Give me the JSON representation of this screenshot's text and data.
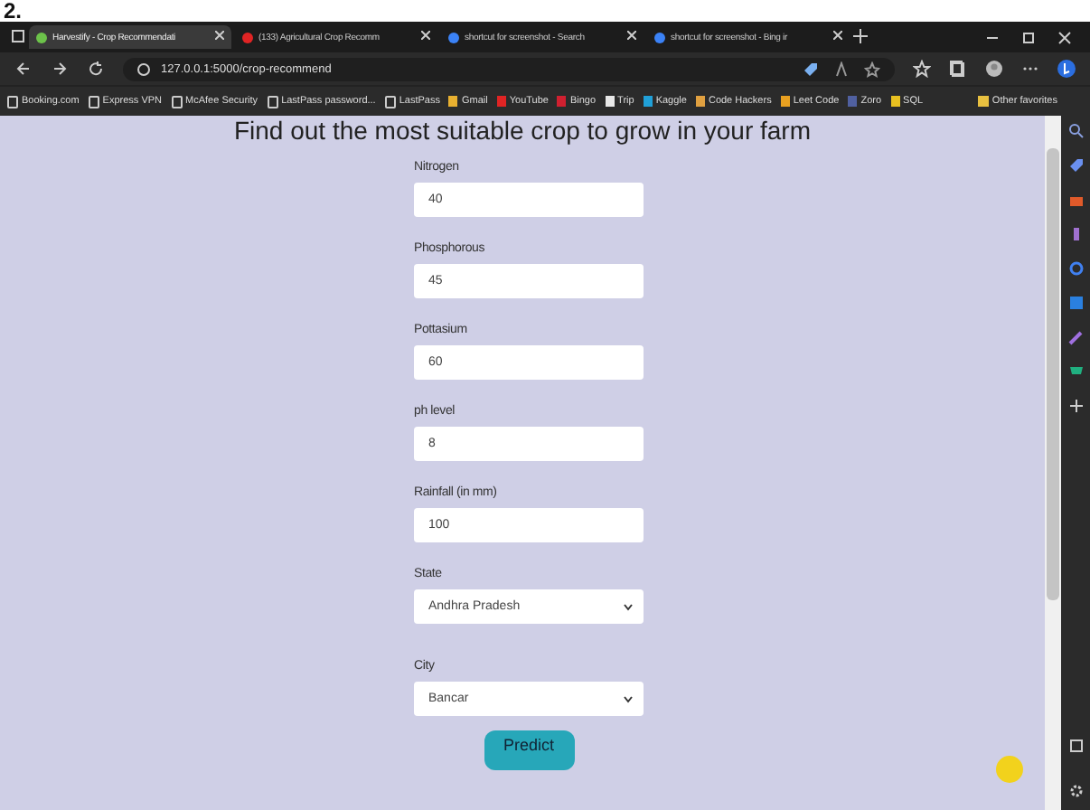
{
  "document_label": "2.",
  "browser": {
    "tabs": [
      {
        "title": "Harvestify - Crop Recommendati",
        "selected": true,
        "color": "#6cc24a"
      },
      {
        "title": "(133) Agricultural Crop Recomm",
        "selected": false,
        "color": "#e02424"
      },
      {
        "title": "shortcut for screenshot - Search",
        "selected": false,
        "color": "#3b82f6"
      },
      {
        "title": "shortcut for screenshot - Bing ir",
        "selected": false,
        "color": "#3b82f6"
      }
    ],
    "address": "127.0.0.1:5000/crop-recommend",
    "bookmarks": [
      {
        "label": "Booking.com",
        "kind": "page"
      },
      {
        "label": "Express VPN",
        "kind": "page"
      },
      {
        "label": "McAfee Security",
        "kind": "page"
      },
      {
        "label": "LastPass password...",
        "kind": "page"
      },
      {
        "label": "LastPass",
        "kind": "page"
      },
      {
        "label": "Gmail",
        "kind": "site",
        "color": "#e8b030"
      },
      {
        "label": "YouTube",
        "kind": "site",
        "color": "#e02424"
      },
      {
        "label": "Bingo",
        "kind": "site",
        "color": "#d02030"
      },
      {
        "label": "Trip",
        "kind": "site",
        "color": "#e8e8e8"
      },
      {
        "label": "Kaggle",
        "kind": "site",
        "color": "#20a0d8"
      },
      {
        "label": "Code Hackers",
        "kind": "site",
        "color": "#e0a040"
      },
      {
        "label": "Leet Code",
        "kind": "site",
        "color": "#e8a020"
      },
      {
        "label": "Zoro",
        "kind": "site",
        "color": "#5060a0"
      },
      {
        "label": "SQL",
        "kind": "site",
        "color": "#e8c020"
      }
    ],
    "other_favorites": "Other favorites"
  },
  "page": {
    "heading": "Find out the most suitable crop to grow in your farm",
    "fields": [
      {
        "label": "Nitrogen",
        "value": "40",
        "kind": "text"
      },
      {
        "label": "Phosphorous",
        "value": "45",
        "kind": "text"
      },
      {
        "label": "Pottasium",
        "value": "60",
        "kind": "text"
      },
      {
        "label": "ph level",
        "value": "8",
        "kind": "text"
      },
      {
        "label": "Rainfall (in mm)",
        "value": "100",
        "kind": "text"
      },
      {
        "label": "State",
        "value": "Andhra Pradesh",
        "kind": "select"
      },
      {
        "label": "City",
        "value": "Bancar",
        "kind": "select"
      }
    ],
    "button": "Predict"
  }
}
